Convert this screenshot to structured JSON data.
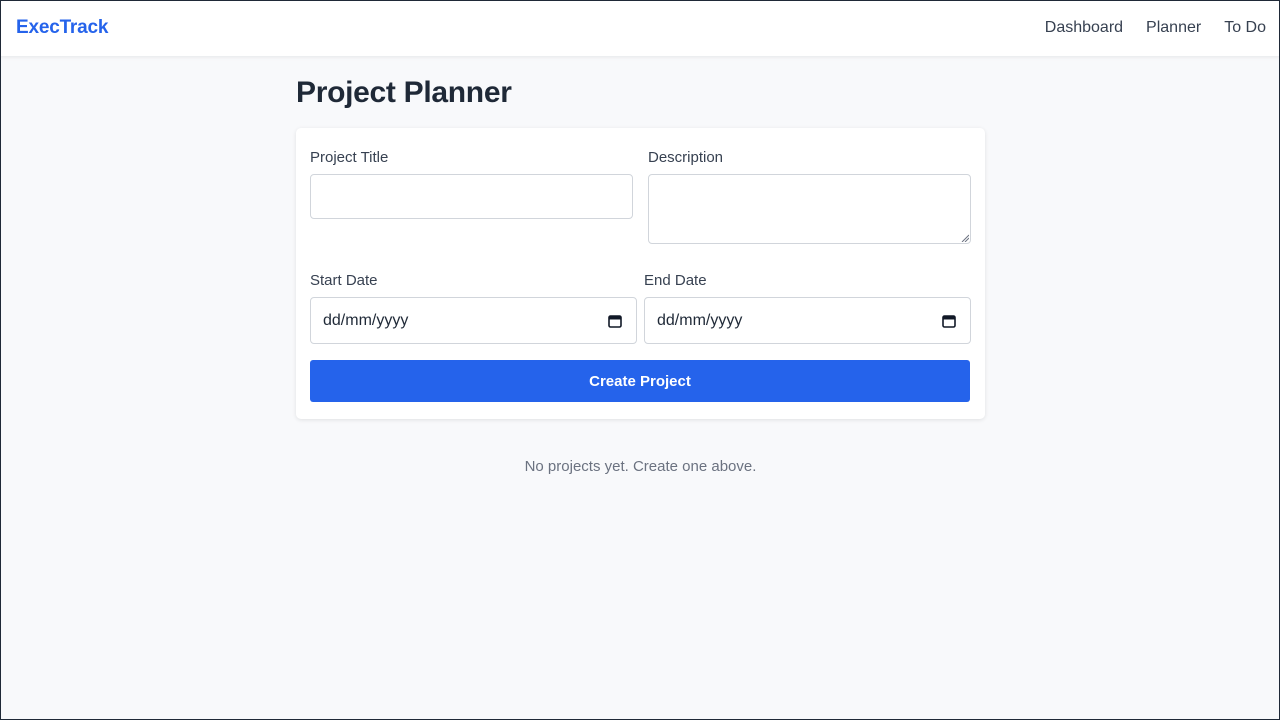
{
  "navbar": {
    "brand": "ExecTrack",
    "links": [
      "Dashboard",
      "Planner",
      "To Do"
    ]
  },
  "page": {
    "title": "Project Planner"
  },
  "form": {
    "title_label": "Project Title",
    "title_value": "",
    "description_label": "Description",
    "description_value": "",
    "start_label": "Start Date",
    "start_value": "dd/mm/yyyy",
    "end_label": "End Date",
    "end_value": "dd/mm/yyyy",
    "submit_label": "Create Project"
  },
  "empty_state": "No projects yet. Create one above.",
  "colors": {
    "accent": "#2563eb",
    "background": "#f8f9fb"
  },
  "icons": {
    "date_picker": "calendar-icon"
  }
}
